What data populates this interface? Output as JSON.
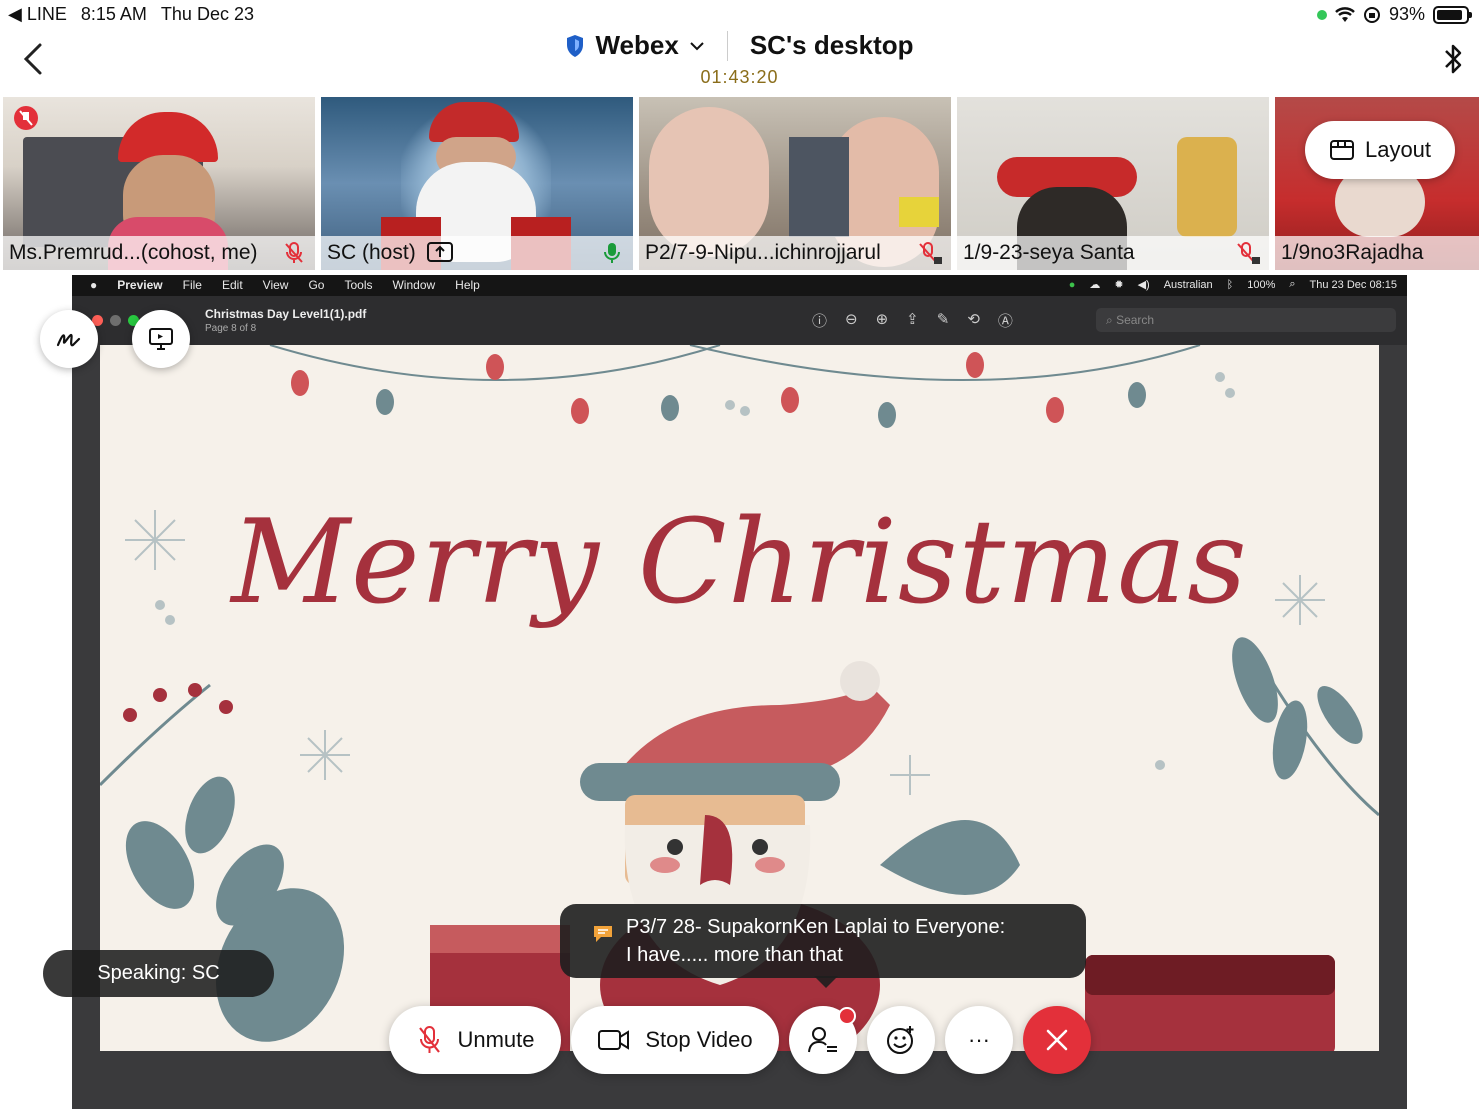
{
  "status_bar": {
    "back_app": "◀ LINE",
    "time": "8:15 AM",
    "date": "Thu Dec 23",
    "battery": "93%"
  },
  "header": {
    "app_name": "Webex",
    "title": "SC's desktop",
    "timer": "01:43:20"
  },
  "participants": [
    {
      "name": "Ms.Premrud...(cohost, me)",
      "mic": "muted"
    },
    {
      "name": "SC (host)",
      "mic": "active"
    },
    {
      "name": "P2/7-9-Nipu...ichinrojjarul",
      "mic": "muted-locked"
    },
    {
      "name": "1/9-23-seya Santa",
      "mic": "muted-locked"
    },
    {
      "name": "1/9no3Rajadha",
      "mic": ""
    }
  ],
  "layout_button": "Layout",
  "shared_screen": {
    "menubar": {
      "items": [
        "Preview",
        "File",
        "Edit",
        "View",
        "Go",
        "Tools",
        "Window",
        "Help"
      ],
      "keyboard": "Australian",
      "battery": "100%",
      "clock": "Thu 23 Dec  08:15"
    },
    "document": {
      "title": "Christmas Day Level1(1).pdf",
      "page": "Page 8 of 8",
      "search_placeholder": "Search"
    },
    "slide_text": "Merry Christmas"
  },
  "speaking": "Speaking: SC",
  "chat_toast": {
    "line1": "P3/7 28- SupakornKen Laplai to Everyone:",
    "line2": "I have..... more than that"
  },
  "controls": {
    "unmute": "Unmute",
    "stop_video": "Stop Video",
    "more": "···"
  },
  "colors": {
    "end_call": "#e3303a",
    "slide_text": "#a5313d",
    "webex_blue": "#1f5fc7"
  }
}
